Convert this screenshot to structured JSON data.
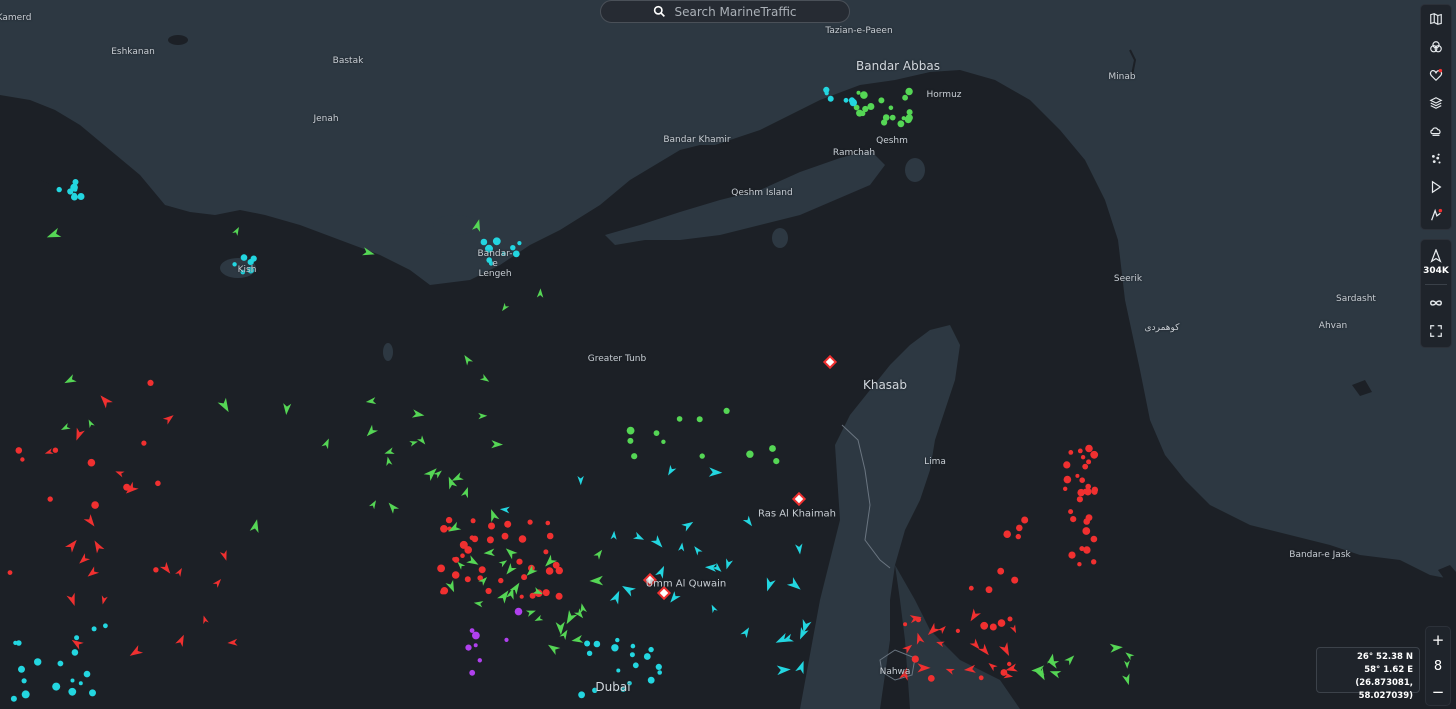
{
  "search": {
    "placeholder": "Search MarineTraffic"
  },
  "colors": {
    "sea": "#1c2026",
    "land": "#2d3842",
    "red": "#f03030",
    "green": "#55d655",
    "cyan": "#23d6e0",
    "purple": "#b040ee",
    "blue": "#4b7cff",
    "pink": "#ff9db0"
  },
  "places": [
    {
      "name": "Kamerd"
    },
    {
      "name": "Eshkanan"
    },
    {
      "name": "Bastak"
    },
    {
      "name": "Jenah"
    },
    {
      "name": "Tazian-e-Paeen"
    },
    {
      "name": "Bandar Abbas"
    },
    {
      "name": "Minab"
    },
    {
      "name": "Hormuz"
    },
    {
      "name": "Bandar Khamir"
    },
    {
      "name": "Ramchah"
    },
    {
      "name": "Qeshm"
    },
    {
      "name": "Qeshm Island"
    },
    {
      "name": "Kish"
    },
    {
      "name": "Bandar-e Lengeh"
    },
    {
      "name": "Greater Tunb"
    },
    {
      "name": "Khasab"
    },
    {
      "name": "Seerik"
    },
    {
      "name": "Sardasht"
    },
    {
      "name": "کوهمردی"
    },
    {
      "name": "Ahvan"
    },
    {
      "name": "Lima"
    },
    {
      "name": "Ras Al Khaimah"
    },
    {
      "name": "Umm Al Quwain"
    },
    {
      "name": "Dubai"
    },
    {
      "name": "Nahwa"
    },
    {
      "name": "Bandar-e Jask"
    }
  ],
  "toolbar": {
    "buttons": [
      "map-icon",
      "filters-icon",
      "favorites-icon",
      "layers-icon",
      "weather-icon",
      "density-icon",
      "playback-icon",
      "routes-icon"
    ],
    "vessel_count": "304K"
  },
  "zoom": {
    "plus": "+",
    "level": "8",
    "minus": "−"
  },
  "coordinates": {
    "lat": "26° 52.38 N",
    "lon": "58° 1.62 E",
    "decimal": "(26.873081, 58.027039)"
  }
}
